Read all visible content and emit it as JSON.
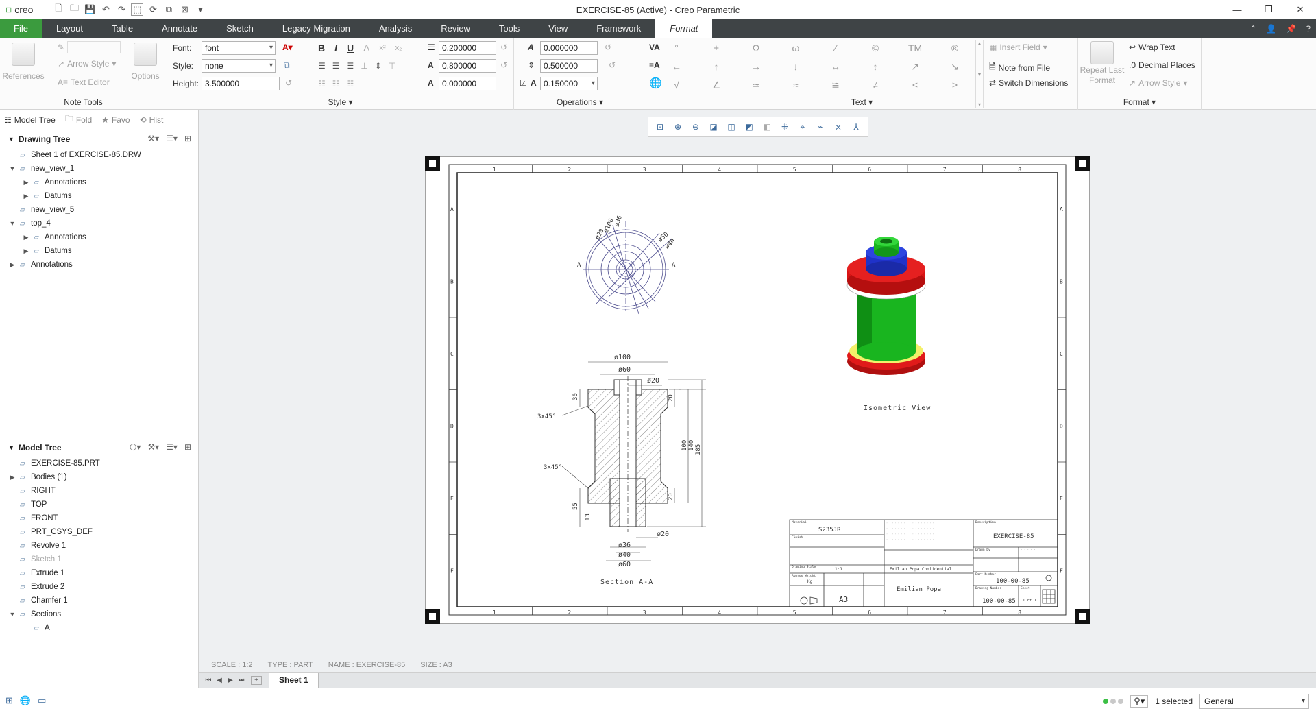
{
  "titlebar": {
    "app_name": "creo",
    "window_title": "EXERCISE-85 (Active) - Creo Parametric"
  },
  "menu": {
    "items": [
      "File",
      "Layout",
      "Table",
      "Annotate",
      "Sketch",
      "Legacy Migration",
      "Analysis",
      "Review",
      "Tools",
      "View",
      "Framework",
      "Format"
    ]
  },
  "ribbon": {
    "note_tools": {
      "label": "Note Tools",
      "references": "References",
      "arrow_style": "Arrow Style",
      "text_editor": "Text Editor",
      "options": "Options"
    },
    "style": {
      "label": "Style",
      "font_label": "Font:",
      "font_value": "font",
      "style_label": "Style:",
      "style_value": "none",
      "height_label": "Height:",
      "height_value": "3.500000",
      "val1": "0.200000",
      "val2": "0.800000",
      "val3": "0.000000"
    },
    "operations": {
      "label": "Operations",
      "val1": "0.000000",
      "val2": "0.500000",
      "val3": "0.150000"
    },
    "text": {
      "label": "Text",
      "symbols": [
        "°",
        "±",
        "Ω",
        "ω",
        "⁄",
        "©",
        "TM",
        "®",
        "←",
        "↑",
        "→",
        "↓",
        "↔",
        "↕",
        "↗",
        "↘",
        "√",
        "∠",
        "≃",
        "≈",
        "≌",
        "≠",
        "≤",
        "≥"
      ],
      "insert_field": "Insert Field",
      "note_from_file": "Note from File",
      "switch_dimensions": "Switch Dimensions"
    },
    "format": {
      "label": "Format",
      "repeat_last": "Repeat Last",
      "repeat_last2": "Format",
      "wrap_text": "Wrap Text",
      "decimal_places": "Decimal Places",
      "arrow_style": "Arrow Style"
    }
  },
  "left_panel": {
    "tabs": [
      "Model Tree",
      "Fold",
      "Favo",
      "Hist"
    ],
    "drawing_tree": {
      "title": "Drawing Tree",
      "items": [
        {
          "label": "Sheet 1 of EXERCISE-85.DRW",
          "level": 0,
          "toggle": ""
        },
        {
          "label": "new_view_1",
          "level": 0,
          "toggle": "▼"
        },
        {
          "label": "Annotations",
          "level": 1,
          "toggle": "▶"
        },
        {
          "label": "Datums",
          "level": 1,
          "toggle": "▶"
        },
        {
          "label": "new_view_5",
          "level": 0,
          "toggle": ""
        },
        {
          "label": "top_4",
          "level": 0,
          "toggle": "▼"
        },
        {
          "label": "Annotations",
          "level": 1,
          "toggle": "▶"
        },
        {
          "label": "Datums",
          "level": 1,
          "toggle": "▶"
        },
        {
          "label": "Annotations",
          "level": 0,
          "toggle": "▶"
        }
      ]
    },
    "model_tree": {
      "title": "Model Tree",
      "items": [
        {
          "label": "EXERCISE-85.PRT",
          "level": 0,
          "toggle": ""
        },
        {
          "label": "Bodies (1)",
          "level": 0,
          "toggle": "▶"
        },
        {
          "label": "RIGHT",
          "level": 0,
          "toggle": ""
        },
        {
          "label": "TOP",
          "level": 0,
          "toggle": ""
        },
        {
          "label": "FRONT",
          "level": 0,
          "toggle": ""
        },
        {
          "label": "PRT_CSYS_DEF",
          "level": 0,
          "toggle": ""
        },
        {
          "label": "Revolve 1",
          "level": 0,
          "toggle": ""
        },
        {
          "label": "Sketch 1",
          "level": 0,
          "toggle": "",
          "dim": true
        },
        {
          "label": "Extrude 1",
          "level": 0,
          "toggle": ""
        },
        {
          "label": "Extrude 2",
          "level": 0,
          "toggle": ""
        },
        {
          "label": "Chamfer 1",
          "level": 0,
          "toggle": ""
        },
        {
          "label": "Sections",
          "level": 0,
          "toggle": "▼"
        },
        {
          "label": "A",
          "level": 1,
          "toggle": ""
        }
      ]
    }
  },
  "drawing": {
    "col_numbers": [
      "1",
      "2",
      "3",
      "4",
      "5",
      "6",
      "7",
      "8"
    ],
    "row_letters": [
      "A",
      "B",
      "C",
      "D",
      "E",
      "F"
    ],
    "section_label": "Section A-A",
    "iso_label": "Isometric View",
    "dims": {
      "d100": "ø100",
      "d60": "ø60",
      "d20": "ø20",
      "d36": "ø36",
      "d40": "ø40",
      "d60b": "ø60",
      "d20b": "ø20",
      "h30": "30",
      "h20": "20",
      "h100": "100",
      "h140": "140",
      "h185": "185",
      "h55": "55",
      "h13": "13",
      "h20b": "20",
      "c1": "3x45°",
      "c2": "3x45°",
      "t40": "ø40",
      "t50": "ø50",
      "t20": "ø20",
      "t100": "ø100",
      "t36": "ø36",
      "a1": "A",
      "a2": "A"
    },
    "title_block": {
      "material_label": "Material",
      "material": "S235JR",
      "finish_label": "Finish",
      "description_label": "Description",
      "description": "EXERCISE-85",
      "drawn_label": "Drawn by",
      "sheet_label": "Sheet",
      "part_number_label": "Part Number",
      "part_number": "100-00-85",
      "drawing_number_label": "Drawing Number",
      "drawing_number": "100-00-85",
      "sheet_size": "A3",
      "scale_label": "Drawing Scale",
      "scale": "1:1",
      "weight_label": "Approx Weight",
      "weight": "Kg",
      "owner": "Emilian Popa",
      "confidential": "Emilian Popa Confidential",
      "sheet_of": "1 of 1"
    }
  },
  "status_info": {
    "scale": "SCALE : 1:2",
    "type": "TYPE : PART",
    "name": "NAME : EXERCISE-85",
    "size": "SIZE : A3"
  },
  "sheet_tab": "Sheet 1",
  "statusbar": {
    "selected": "1 selected",
    "filter": "General"
  }
}
